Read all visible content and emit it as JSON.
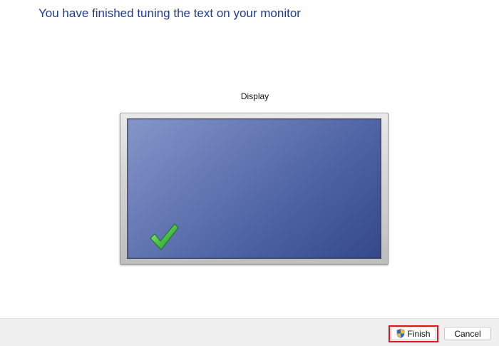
{
  "heading": "You have finished tuning the text on your monitor",
  "display": {
    "label": "Display",
    "status_icon": "checkmark-icon"
  },
  "buttons": {
    "finish": "Finish",
    "finish_icon": "uac-shield-icon",
    "cancel": "Cancel"
  },
  "colors": {
    "heading": "#1e3a9a",
    "screen": "#4c61a2",
    "checkmark": "#3cb83c",
    "highlight": "#e3141b"
  }
}
